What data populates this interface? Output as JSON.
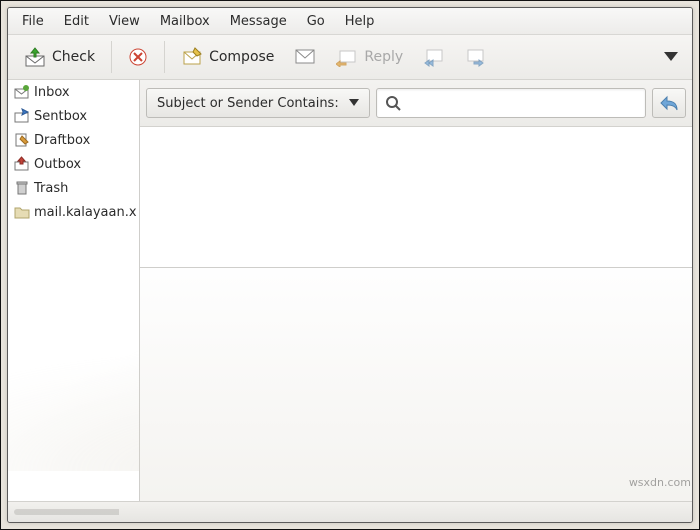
{
  "menu": [
    "File",
    "Edit",
    "View",
    "Mailbox",
    "Message",
    "Go",
    "Help"
  ],
  "toolbar": {
    "check": "Check",
    "compose": "Compose",
    "reply": "Reply"
  },
  "folders": [
    {
      "name": "inbox",
      "label": "Inbox",
      "icon": "inbox"
    },
    {
      "name": "sentbox",
      "label": "Sentbox",
      "icon": "sent"
    },
    {
      "name": "draftbox",
      "label": "Draftbox",
      "icon": "draft"
    },
    {
      "name": "outbox",
      "label": "Outbox",
      "icon": "outbox"
    },
    {
      "name": "trash",
      "label": "Trash",
      "icon": "trash"
    },
    {
      "name": "account",
      "label": "mail.kalayaan.x",
      "icon": "folder"
    }
  ],
  "filter": {
    "label": "Subject or Sender Contains:"
  },
  "search": {
    "placeholder": ""
  },
  "watermark": "wsxdn.com"
}
